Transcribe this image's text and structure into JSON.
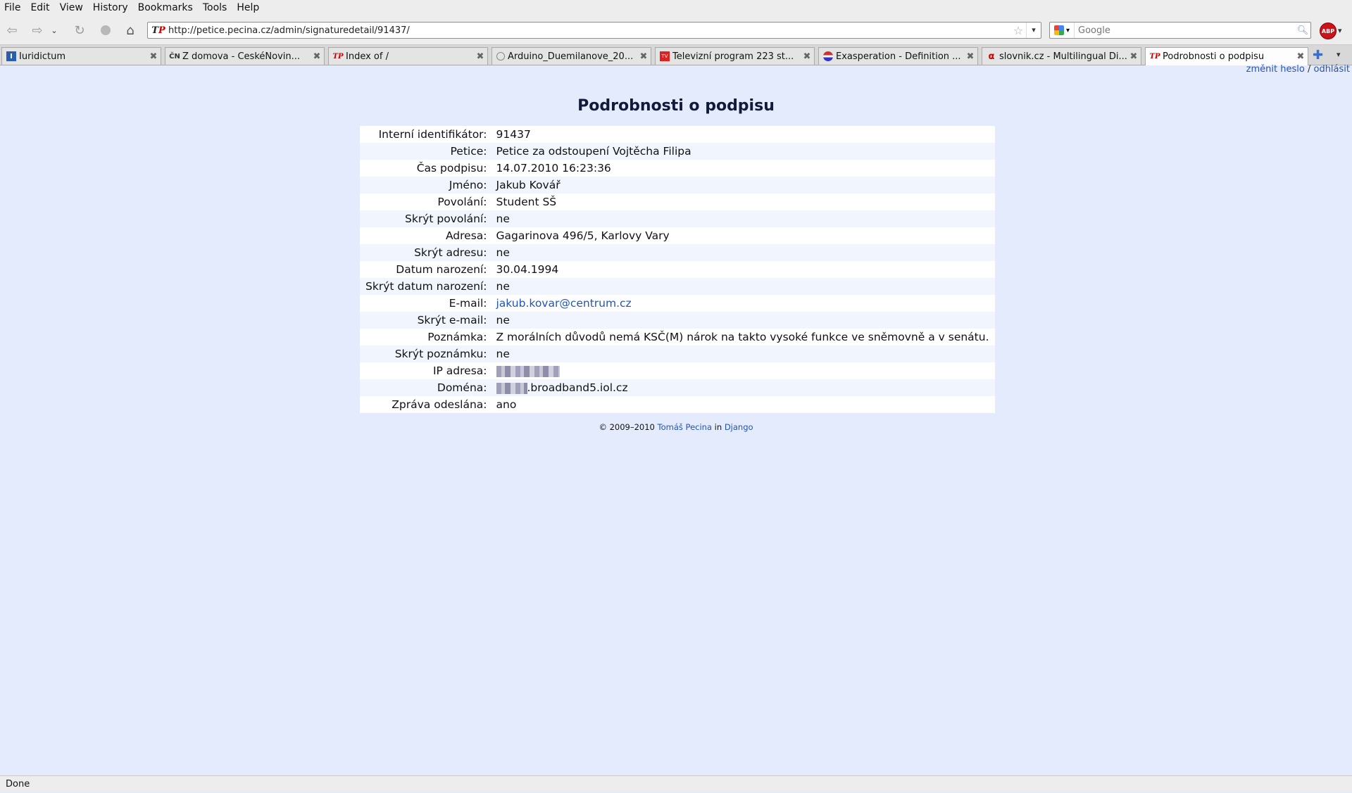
{
  "menu": [
    "File",
    "Edit",
    "View",
    "History",
    "Bookmarks",
    "Tools",
    "Help"
  ],
  "url": "http://petice.pecina.cz/admin/signaturedetail/91437/",
  "search": {
    "placeholder": "Google"
  },
  "tabs": [
    {
      "title": "Iuridictum",
      "icon": "iuridictum-favicon"
    },
    {
      "title": "Z domova - ČeskéNovin...",
      "icon": "ceskenoviny-favicon"
    },
    {
      "title": "Index of /",
      "icon": "tp-favicon"
    },
    {
      "title": "Arduino_Duemilanove_20...",
      "icon": "page-favicon"
    },
    {
      "title": "Televizní program 223 st...",
      "icon": "tv-favicon"
    },
    {
      "title": "Exasperation - Definition ...",
      "icon": "dictionary-favicon"
    },
    {
      "title": "slovnik.cz - Multilingual Di...",
      "icon": "slovnik-favicon"
    },
    {
      "title": "Podrobnosti o podpisu",
      "icon": "tp-favicon",
      "active": true
    }
  ],
  "user_links": {
    "change_password": "změnit heslo",
    "separator": "/",
    "logout": "odhlásit"
  },
  "page_title": "Podrobnosti o podpisu",
  "details": [
    {
      "label": "Interní identifikátor:",
      "value": "91437"
    },
    {
      "label": "Petice:",
      "value": "Petice za odstoupení Vojtěcha Filipa"
    },
    {
      "label": "Čas podpisu:",
      "value": "14.07.2010 16:23:36"
    },
    {
      "label": "Jméno:",
      "value": "Jakub Kovář"
    },
    {
      "label": "Povolání:",
      "value": "Student SŠ"
    },
    {
      "label": "Skrýt povolání:",
      "value": "ne"
    },
    {
      "label": "Adresa:",
      "value": "Gagarinova 496/5, Karlovy Vary"
    },
    {
      "label": "Skrýt adresu:",
      "value": "ne"
    },
    {
      "label": "Datum narození:",
      "value": "30.04.1994"
    },
    {
      "label": "Skrýt datum narození:",
      "value": "ne"
    },
    {
      "label": "E-mail:",
      "value": "jakub.kovar@centrum.cz"
    },
    {
      "label": "Skrýt e-mail:",
      "value": "ne"
    },
    {
      "label": "Poznámka:",
      "value": "Z morálních důvodů nemá KSČ(M) nárok na takto vysoké funkce ve sněmovně a v senátu."
    },
    {
      "label": "Skrýt poznámku:",
      "value": "ne"
    },
    {
      "label": "IP adresa:",
      "value": ""
    },
    {
      "label": "Doména:",
      "value": ".broadband5.iol.cz"
    },
    {
      "label": "Zpráva odeslána:",
      "value": "ano"
    }
  ],
  "footer": {
    "copyright": "© 2009–2010",
    "author": "Tomáš Pecina",
    "in": "in",
    "framework": "Django"
  },
  "status": "Done",
  "colors": {
    "page_bg": "#e3ebfd",
    "link": "#2454b8"
  }
}
